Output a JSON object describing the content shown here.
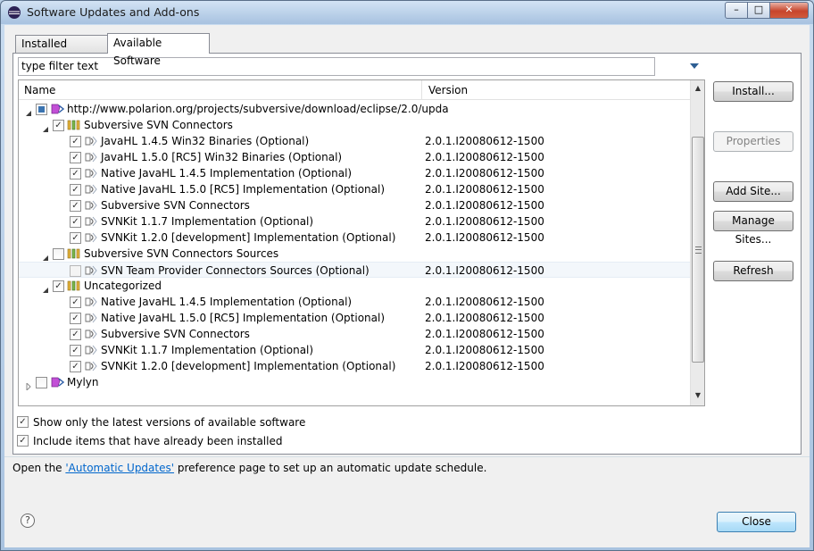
{
  "window": {
    "title": "Software Updates and Add-ons",
    "min_glyph": "–",
    "max_glyph": "□",
    "close_glyph": "✕"
  },
  "tabs": [
    {
      "label": "Installed Software",
      "active": false
    },
    {
      "label": "Available Software",
      "active": true
    }
  ],
  "filter": {
    "value": "type filter text"
  },
  "tree": {
    "columns": {
      "name": "Name",
      "version": "Version"
    },
    "rows": [
      {
        "level": 0,
        "expanded": true,
        "check": "tri",
        "icon": "site-icon",
        "label": "http://www.polarion.org/projects/subversive/download/eclipse/2.0/upda",
        "version": ""
      },
      {
        "level": 1,
        "expanded": true,
        "check": "checked",
        "icon": "category-icon",
        "label": "Subversive SVN Connectors",
        "version": ""
      },
      {
        "level": 2,
        "check": "checked",
        "icon": "feature-icon",
        "label": "JavaHL 1.4.5 Win32 Binaries (Optional)",
        "version": "2.0.1.I20080612-1500"
      },
      {
        "level": 2,
        "check": "checked",
        "icon": "feature-icon",
        "label": "JavaHL 1.5.0 [RC5] Win32 Binaries (Optional)",
        "version": "2.0.1.I20080612-1500"
      },
      {
        "level": 2,
        "check": "checked",
        "icon": "feature-icon",
        "label": "Native JavaHL 1.4.5 Implementation (Optional)",
        "version": "2.0.1.I20080612-1500"
      },
      {
        "level": 2,
        "check": "checked",
        "icon": "feature-icon",
        "label": "Native JavaHL 1.5.0 [RC5] Implementation (Optional)",
        "version": "2.0.1.I20080612-1500"
      },
      {
        "level": 2,
        "check": "checked",
        "icon": "feature-icon",
        "label": "Subversive SVN Connectors",
        "version": "2.0.1.I20080612-1500"
      },
      {
        "level": 2,
        "check": "checked",
        "icon": "feature-icon",
        "label": "SVNKit 1.1.7 Implementation (Optional)",
        "version": "2.0.1.I20080612-1500"
      },
      {
        "level": 2,
        "check": "checked",
        "icon": "feature-icon",
        "label": "SVNKit 1.2.0 [development] Implementation (Optional)",
        "version": "2.0.1.I20080612-1500"
      },
      {
        "level": 1,
        "expanded": true,
        "check": "unchecked",
        "icon": "category-icon",
        "label": "Subversive SVN Connectors Sources",
        "version": ""
      },
      {
        "level": 2,
        "check": "unchecked",
        "icon": "feature-icon",
        "label": "SVN Team Provider Connectors Sources (Optional)",
        "version": "2.0.1.I20080612-1500",
        "selected": true
      },
      {
        "level": 1,
        "expanded": true,
        "check": "checked",
        "icon": "category-icon",
        "label": "Uncategorized",
        "version": ""
      },
      {
        "level": 2,
        "check": "checked",
        "icon": "feature-icon",
        "label": "Native JavaHL 1.4.5 Implementation (Optional)",
        "version": "2.0.1.I20080612-1500"
      },
      {
        "level": 2,
        "check": "checked",
        "icon": "feature-icon",
        "label": "Native JavaHL 1.5.0 [RC5] Implementation (Optional)",
        "version": "2.0.1.I20080612-1500"
      },
      {
        "level": 2,
        "check": "checked",
        "icon": "feature-icon",
        "label": "Subversive SVN Connectors",
        "version": "2.0.1.I20080612-1500"
      },
      {
        "level": 2,
        "check": "checked",
        "icon": "feature-icon",
        "label": "SVNKit 1.1.7 Implementation (Optional)",
        "version": "2.0.1.I20080612-1500"
      },
      {
        "level": 2,
        "check": "checked",
        "icon": "feature-icon",
        "label": "SVNKit 1.2.0 [development] Implementation (Optional)",
        "version": "2.0.1.I20080612-1500"
      },
      {
        "level": 0,
        "expanded": false,
        "check": "unchecked",
        "icon": "site-icon",
        "label": "Mylyn",
        "version": ""
      }
    ]
  },
  "options": {
    "latest_only": {
      "label": "Show only the latest versions of available software",
      "checked": true
    },
    "include_installed": {
      "label": "Include items that have already been installed",
      "checked": true
    }
  },
  "buttons": {
    "install": "Install...",
    "properties": "Properties",
    "add_site": "Add Site...",
    "manage_sites": "Manage Sites...",
    "refresh": "Refresh",
    "close": "Close",
    "help": "?"
  },
  "info": {
    "prefix": "Open the ",
    "link": "'Automatic Updates'",
    "suffix": " preference page to set up an automatic update schedule."
  },
  "scroll": {
    "up_glyph": "▲",
    "down_glyph": "▼"
  },
  "colors": {
    "link": "#0066cc",
    "selection": "#f3f7fb",
    "accent": "#3a73b0"
  }
}
